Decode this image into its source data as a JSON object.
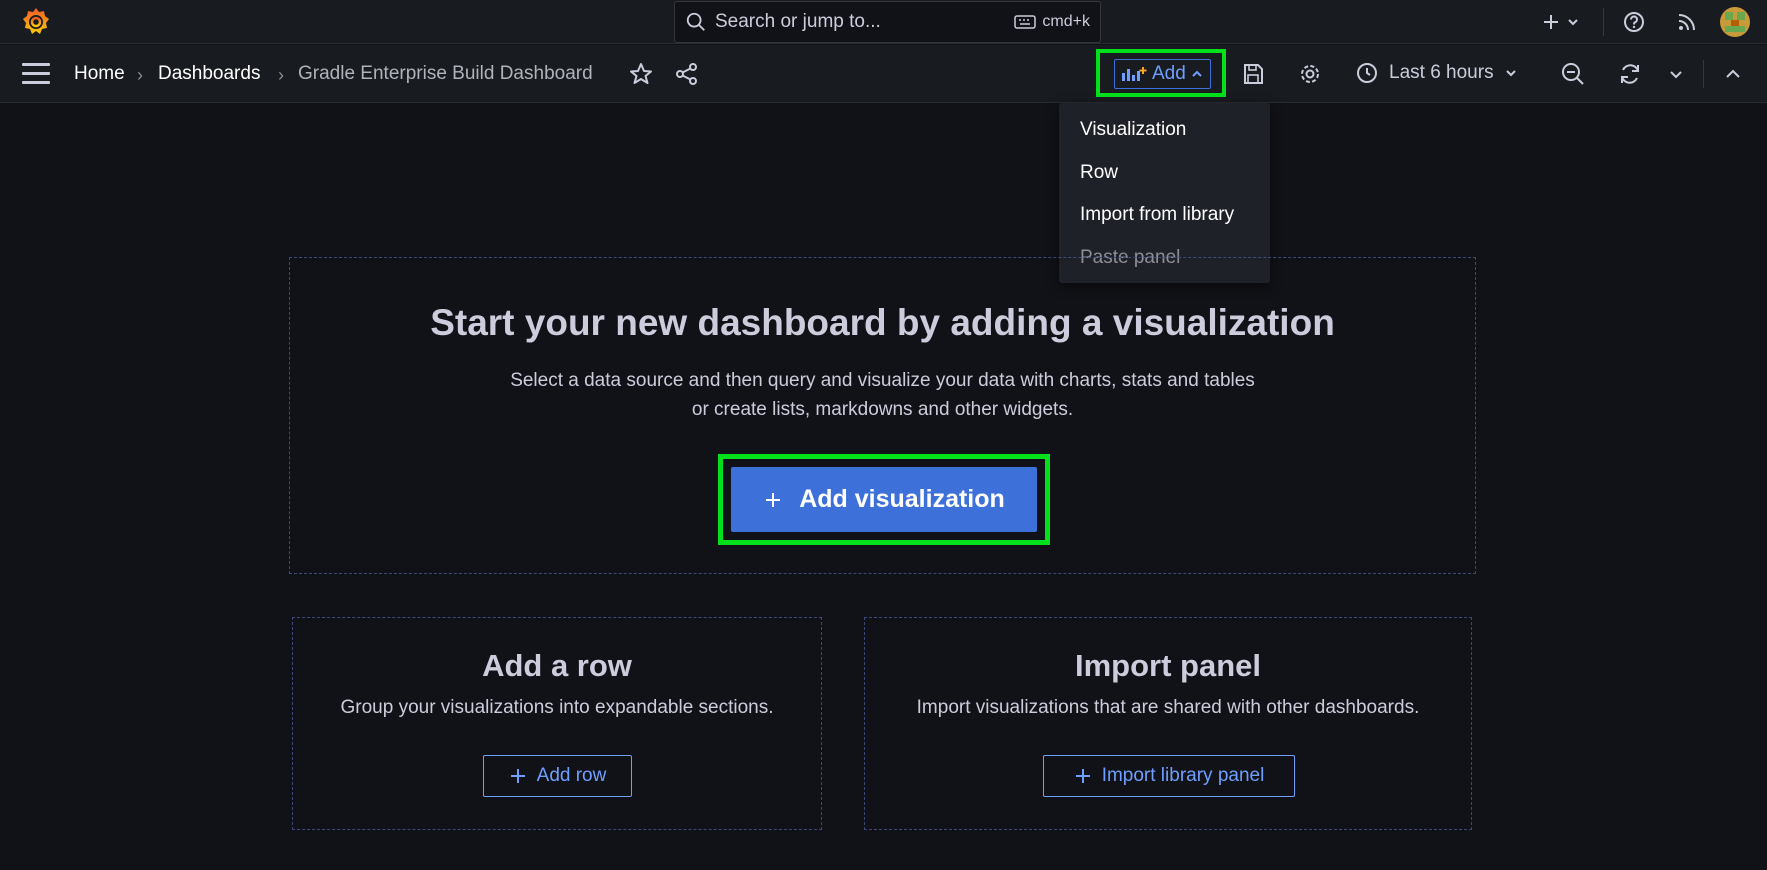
{
  "search": {
    "placeholder": "Search or jump to...",
    "shortcut": "cmd+k"
  },
  "breadcrumb": {
    "home": "Home",
    "dashboards": "Dashboards",
    "current": "Gradle Enterprise Build Dashboard"
  },
  "toolbar": {
    "add_label": "Add",
    "time_range": "Last 6 hours"
  },
  "add_menu": {
    "items": [
      {
        "label": "Visualization"
      },
      {
        "label": "Row"
      },
      {
        "label": "Import from library"
      },
      {
        "label": "Paste panel"
      }
    ]
  },
  "empty_state": {
    "title": "Start your new dashboard by adding a visualization",
    "subtitle_line1": "Select a data source and then query and visualize your data with charts, stats and tables",
    "subtitle_line2": "or create lists, markdowns and other widgets.",
    "add_visualization_label": "Add visualization"
  },
  "add_row_card": {
    "title": "Add a row",
    "subtitle": "Group your visualizations into expandable sections.",
    "button_label": "Add row"
  },
  "import_card": {
    "title": "Import panel",
    "subtitle": "Import visualizations that are shared with other dashboards.",
    "button_label": "Import library panel"
  },
  "colors": {
    "accent": "#3d71d9",
    "link": "#6e9fff",
    "highlight": "#00e01b",
    "background": "#111217",
    "bar": "#181b1f"
  }
}
